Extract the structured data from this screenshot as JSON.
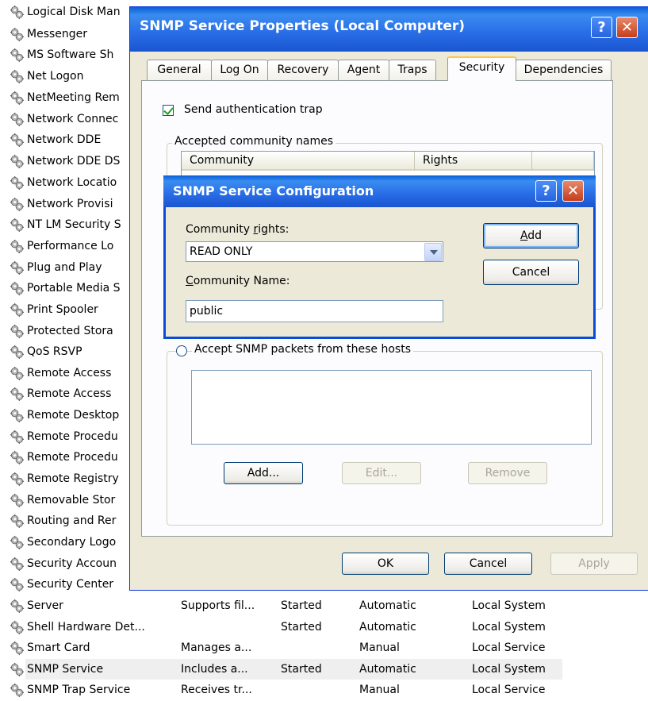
{
  "services": [
    {
      "name": "Logical Disk Man",
      "description": "",
      "status": "",
      "startup": "",
      "logon": "",
      "selected": false
    },
    {
      "name": "Messenger",
      "description": "",
      "status": "",
      "startup": "",
      "logon": "",
      "selected": false
    },
    {
      "name": "MS Software Sh",
      "description": "",
      "status": "",
      "startup": "",
      "logon": "",
      "selected": false
    },
    {
      "name": "Net Logon",
      "description": "",
      "status": "",
      "startup": "",
      "logon": "",
      "selected": false
    },
    {
      "name": "NetMeeting Rem",
      "description": "",
      "status": "",
      "startup": "",
      "logon": "",
      "selected": false
    },
    {
      "name": "Network Connec",
      "description": "",
      "status": "",
      "startup": "",
      "logon": "",
      "selected": false
    },
    {
      "name": "Network DDE",
      "description": "",
      "status": "",
      "startup": "",
      "logon": "",
      "selected": false
    },
    {
      "name": "Network DDE DS",
      "description": "",
      "status": "",
      "startup": "",
      "logon": "",
      "selected": false
    },
    {
      "name": "Network Locatio",
      "description": "",
      "status": "",
      "startup": "",
      "logon": "",
      "selected": false
    },
    {
      "name": "Network Provisi",
      "description": "",
      "status": "",
      "startup": "",
      "logon": "",
      "selected": false
    },
    {
      "name": "NT LM Security S",
      "description": "",
      "status": "",
      "startup": "",
      "logon": "",
      "selected": false
    },
    {
      "name": "Performance Lo",
      "description": "",
      "status": "",
      "startup": "",
      "logon": "",
      "selected": false
    },
    {
      "name": "Plug and Play",
      "description": "",
      "status": "",
      "startup": "",
      "logon": "",
      "selected": false
    },
    {
      "name": "Portable Media S",
      "description": "",
      "status": "",
      "startup": "",
      "logon": "",
      "selected": false
    },
    {
      "name": "Print Spooler",
      "description": "",
      "status": "",
      "startup": "",
      "logon": "",
      "selected": false
    },
    {
      "name": "Protected Stora",
      "description": "",
      "status": "",
      "startup": "",
      "logon": "",
      "selected": false
    },
    {
      "name": "QoS RSVP",
      "description": "",
      "status": "",
      "startup": "",
      "logon": "",
      "selected": false
    },
    {
      "name": "Remote Access",
      "description": "",
      "status": "",
      "startup": "",
      "logon": "",
      "selected": false
    },
    {
      "name": "Remote Access",
      "description": "",
      "status": "",
      "startup": "",
      "logon": "",
      "selected": false
    },
    {
      "name": "Remote Desktop",
      "description": "",
      "status": "",
      "startup": "",
      "logon": "",
      "selected": false
    },
    {
      "name": "Remote Procedu",
      "description": "",
      "status": "",
      "startup": "",
      "logon": "",
      "selected": false
    },
    {
      "name": "Remote Procedu",
      "description": "",
      "status": "",
      "startup": "",
      "logon": "",
      "selected": false
    },
    {
      "name": "Remote Registry",
      "description": "",
      "status": "",
      "startup": "",
      "logon": "",
      "selected": false
    },
    {
      "name": "Removable Stor",
      "description": "",
      "status": "",
      "startup": "",
      "logon": "",
      "selected": false
    },
    {
      "name": "Routing and Rer",
      "description": "",
      "status": "",
      "startup": "",
      "logon": "",
      "selected": false
    },
    {
      "name": "Secondary Logo",
      "description": "",
      "status": "",
      "startup": "",
      "logon": "",
      "selected": false
    },
    {
      "name": "Security Accoun",
      "description": "",
      "status": "",
      "startup": "",
      "logon": "",
      "selected": false
    },
    {
      "name": "Security Center",
      "description": "",
      "status": "",
      "startup": "",
      "logon": "",
      "selected": false
    },
    {
      "name": "Server",
      "description": "Supports fil...",
      "status": "Started",
      "startup": "Automatic",
      "logon": "Local System",
      "selected": false
    },
    {
      "name": "Shell Hardware Det...",
      "description": "",
      "status": "Started",
      "startup": "Automatic",
      "logon": "Local System",
      "selected": false
    },
    {
      "name": "Smart Card",
      "description": "Manages a...",
      "status": "",
      "startup": "Manual",
      "logon": "Local Service",
      "selected": false
    },
    {
      "name": "SNMP Service",
      "description": "Includes a...",
      "status": "Started",
      "startup": "Automatic",
      "logon": "Local System",
      "selected": true
    },
    {
      "name": "SNMP Trap Service",
      "description": "Receives tr...",
      "status": "",
      "startup": "Manual",
      "logon": "Local Service",
      "selected": false
    }
  ],
  "properties_window": {
    "title": "SNMP Service Properties (Local Computer)",
    "help_glyph": "?",
    "close_glyph": "✕",
    "tabs": [
      "General",
      "Log On",
      "Recovery",
      "Agent",
      "Traps",
      "Security",
      "Dependencies"
    ],
    "active_tab": "Security",
    "send_trap_label": "Send authentication trap",
    "send_trap_checked": true,
    "community_group_label": "Accepted community names",
    "community_columns": [
      "Community",
      "Rights"
    ],
    "hosts_radio_label": "Accept SNMP packets from these hosts",
    "hosts_add": "Add...",
    "hosts_edit": "Edit...",
    "hosts_remove": "Remove",
    "ok": "OK",
    "cancel": "Cancel",
    "apply": "Apply"
  },
  "config_dialog": {
    "title": "SNMP Service Configuration",
    "help_glyph": "?",
    "close_glyph": "✕",
    "rights_label": "Community rights:",
    "rights_value": "READ ONLY",
    "name_label": "Community Name:",
    "name_value": "public",
    "add": "Add",
    "cancel": "Cancel"
  },
  "colors": {
    "titlebar_blue": "#2a6fe8",
    "window_face": "#ece9d8",
    "panel_face": "#fcfcfe",
    "close_red": "#c43d1b",
    "tab_highlight": "#ffc83c"
  }
}
